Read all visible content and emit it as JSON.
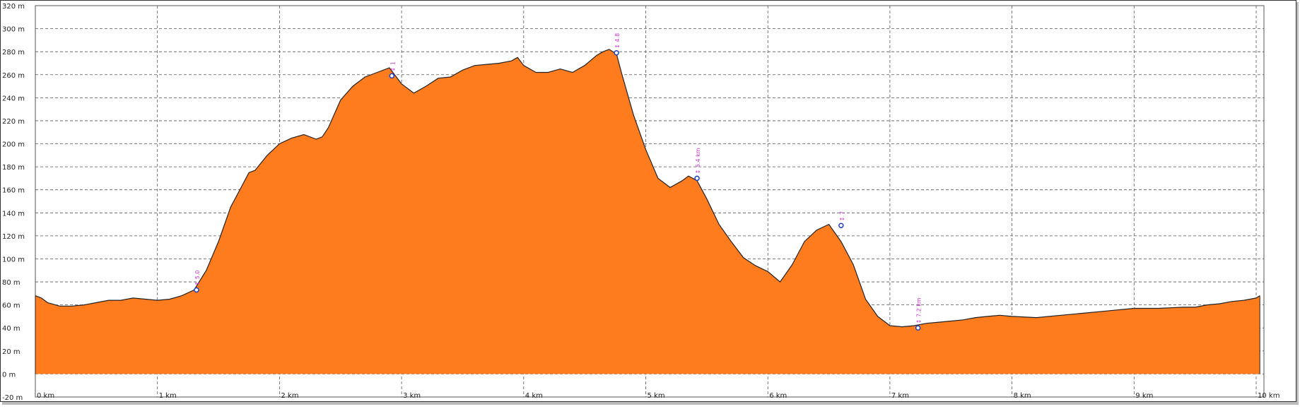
{
  "chart_data": {
    "type": "area",
    "title": "",
    "xlabel": "",
    "ylabel": "",
    "xlim": [
      0,
      10.05
    ],
    "ylim": [
      -20,
      320
    ],
    "grid": true,
    "x_ticks": [
      0,
      1,
      2,
      3,
      4,
      5,
      6,
      7,
      8,
      9,
      10
    ],
    "x_tick_labels": [
      "0 km",
      "1 km",
      "2 km",
      "3 km",
      "4 km",
      "5 km",
      "6 km",
      "7 km",
      "8 km",
      "9 km",
      "10 km"
    ],
    "y_ticks": [
      -20,
      0,
      20,
      40,
      60,
      80,
      100,
      120,
      140,
      160,
      180,
      200,
      220,
      240,
      260,
      280,
      300,
      320
    ],
    "y_tick_labels": [
      "-20 m",
      "0 m",
      "20 m",
      "40 m",
      "60 m",
      "80 m",
      "100 m",
      "120 m",
      "140 m",
      "160 m",
      "180 m",
      "200 m",
      "220 m",
      "240 m",
      "260 m",
      "280 m",
      "300 m",
      "320 m"
    ],
    "colors": {
      "fill": "#ff7c1e",
      "line": "#222222",
      "grid": "#555555",
      "marker": "#1f3fbf",
      "marker_label": "#cc33cc"
    },
    "series": [
      {
        "x": [
          0,
          0.05,
          0.1,
          0.2,
          0.3,
          0.4,
          0.5,
          0.6,
          0.7,
          0.8,
          0.9,
          1.0,
          1.1,
          1.2,
          1.3,
          1.4,
          1.5,
          1.6,
          1.7,
          1.75,
          1.8,
          1.9,
          2.0,
          2.1,
          2.2,
          2.3,
          2.35,
          2.4,
          2.5,
          2.6,
          2.7,
          2.8,
          2.9,
          3.0,
          3.1,
          3.2,
          3.3,
          3.4,
          3.5,
          3.6,
          3.7,
          3.8,
          3.9,
          3.95,
          4.0,
          4.1,
          4.2,
          4.3,
          4.4,
          4.5,
          4.6,
          4.65,
          4.7,
          4.76,
          4.8,
          4.9,
          5.0,
          5.1,
          5.2,
          5.3,
          5.35,
          5.42,
          5.5,
          5.6,
          5.7,
          5.8,
          5.9,
          6.0,
          6.1,
          6.2,
          6.3,
          6.4,
          6.5,
          6.6,
          6.7,
          6.8,
          6.9,
          7.0,
          7.1,
          7.2,
          7.3,
          7.4,
          7.5,
          7.6,
          7.7,
          7.8,
          7.9,
          8.0,
          8.2,
          8.4,
          8.6,
          8.8,
          9.0,
          9.2,
          9.4,
          9.5,
          9.6,
          9.7,
          9.8,
          9.9,
          10.0,
          10.03
        ],
        "y": [
          68,
          66,
          62,
          59,
          59,
          60,
          62,
          64,
          64,
          66,
          65,
          64,
          65,
          68,
          73,
          90,
          115,
          145,
          165,
          175,
          177,
          190,
          200,
          205,
          208,
          204,
          206,
          214,
          238,
          250,
          258,
          262,
          266,
          252,
          244,
          250,
          257,
          258,
          264,
          268,
          269,
          270,
          272,
          275,
          268,
          262,
          262,
          265,
          262,
          268,
          277,
          280,
          282,
          278,
          262,
          225,
          195,
          170,
          162,
          168,
          172,
          168,
          152,
          130,
          115,
          101,
          94,
          89,
          80,
          95,
          115,
          125,
          130,
          115,
          95,
          65,
          50,
          42,
          41,
          42,
          44,
          45,
          46,
          47,
          49,
          50,
          51,
          50,
          49,
          51,
          53,
          55,
          57,
          57,
          58,
          58,
          60,
          61,
          63,
          64,
          66,
          68
        ]
      }
    ],
    "markers": [
      {
        "x": 1.32,
        "y": 73,
        "label": "↕ 5.0"
      },
      {
        "x": 2.92,
        "y": 259,
        "label": "↕ 1"
      },
      {
        "x": 4.76,
        "y": 279,
        "label": "↕ 4.8"
      },
      {
        "x": 5.42,
        "y": 170,
        "label": "↕ 5.4 km"
      },
      {
        "x": 6.6,
        "y": 129,
        "label": "↕ 7"
      },
      {
        "x": 7.23,
        "y": 40,
        "label": "↕ 7.2 km"
      }
    ]
  }
}
